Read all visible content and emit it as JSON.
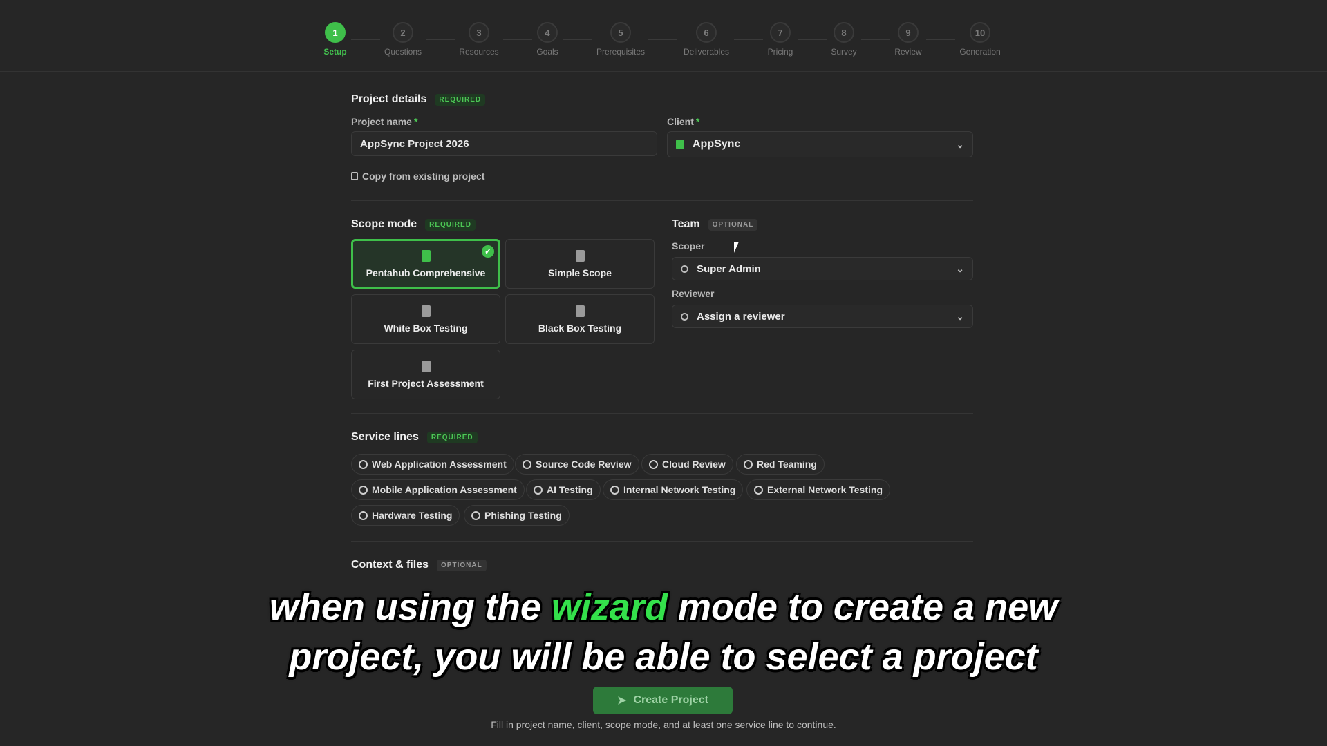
{
  "stepper": {
    "steps": [
      {
        "num": "1",
        "label": "Setup"
      },
      {
        "num": "2",
        "label": "Questions"
      },
      {
        "num": "3",
        "label": "Resources"
      },
      {
        "num": "4",
        "label": "Goals"
      },
      {
        "num": "5",
        "label": "Prerequisites"
      },
      {
        "num": "6",
        "label": "Deliverables"
      },
      {
        "num": "7",
        "label": "Pricing"
      },
      {
        "num": "8",
        "label": "Survey"
      },
      {
        "num": "9",
        "label": "Review"
      },
      {
        "num": "10",
        "label": "Generation"
      }
    ],
    "active_index": 0
  },
  "project_details": {
    "title": "Project details",
    "badge": "REQUIRED",
    "name_label": "Project name",
    "name_value": "AppSync Project 2026",
    "client_label": "Client",
    "client_value": "AppSync",
    "copy_link": "Copy from existing project"
  },
  "scope_mode": {
    "title": "Scope mode",
    "badge": "REQUIRED",
    "options": [
      {
        "label": "Pentahub Comprehensive",
        "selected": true
      },
      {
        "label": "Simple Scope",
        "selected": false
      },
      {
        "label": "White Box Testing",
        "selected": false
      },
      {
        "label": "Black Box Testing",
        "selected": false
      },
      {
        "label": "First Project Assessment",
        "selected": false
      }
    ]
  },
  "team": {
    "title": "Team",
    "badge": "OPTIONAL",
    "scoper_label": "Scoper",
    "scoper_value": "Super Admin",
    "reviewer_label": "Reviewer",
    "reviewer_value": "Assign a reviewer"
  },
  "service_lines": {
    "title": "Service lines",
    "badge": "REQUIRED",
    "items": [
      "Web Application Assessment",
      "Source Code Review",
      "Cloud Review",
      "Red Teaming",
      "Mobile Application Assessment",
      "AI Testing",
      "Internal Network Testing",
      "External Network Testing",
      "Hardware Testing",
      "Phishing Testing"
    ]
  },
  "context_files": {
    "title": "Context & files",
    "badge": "OPTIONAL"
  },
  "caption": {
    "pre": "when using the ",
    "highlight": "wizard",
    "post": " mode to create a new",
    "line2": "project, you will be able to select a project"
  },
  "footer": {
    "create_label": "Create Project",
    "hint": "Fill in project name, client, scope mode, and at least one service line to continue."
  },
  "colors": {
    "accent": "#3fbf4a",
    "background": "#262626"
  }
}
